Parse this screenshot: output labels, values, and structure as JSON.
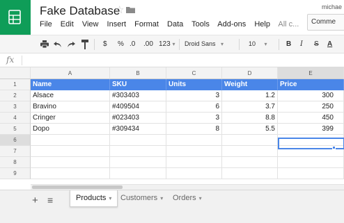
{
  "app": {
    "doc_title": "Fake Database",
    "user_name": "michae",
    "comments_label": "Comme"
  },
  "menu": [
    "File",
    "Edit",
    "View",
    "Insert",
    "Format",
    "Data",
    "Tools",
    "Add-ons",
    "Help"
  ],
  "menu_extra": "All c...",
  "toolbar": {
    "currency": "$",
    "percent": "%",
    "decrease_decimals": ".0",
    "increase_decimals": ".00",
    "more_formats": "123",
    "font": "Droid Sans",
    "font_size": "10",
    "bold": "B",
    "italic": "I",
    "strikethrough": "S",
    "text_color": "A"
  },
  "formula": {
    "fx": "fx",
    "value": ""
  },
  "columns": [
    "A",
    "B",
    "C",
    "D",
    "E"
  ],
  "row_numbers": [
    "1",
    "2",
    "3",
    "4",
    "5",
    "6",
    "7",
    "8",
    "9"
  ],
  "table": {
    "headers": [
      "Name",
      "SKU",
      "Units",
      "Weight",
      "Price"
    ],
    "rows": [
      [
        "Alsace",
        "#303403",
        "3",
        "1.2",
        "300"
      ],
      [
        "Bravino",
        "#409504",
        "6",
        "3.7",
        "250"
      ],
      [
        "Cringer",
        "#023403",
        "3",
        "8.8",
        "450"
      ],
      [
        "Dopo",
        "#309434",
        "8",
        "5.5",
        "399"
      ]
    ]
  },
  "selected_cell": "E6",
  "tabs": [
    {
      "label": "Products",
      "active": true
    },
    {
      "label": "Customers",
      "active": false
    },
    {
      "label": "Orders",
      "active": false
    }
  ],
  "colors": {
    "brand_green": "#0f9d58",
    "header_blue": "#4a86e8"
  }
}
